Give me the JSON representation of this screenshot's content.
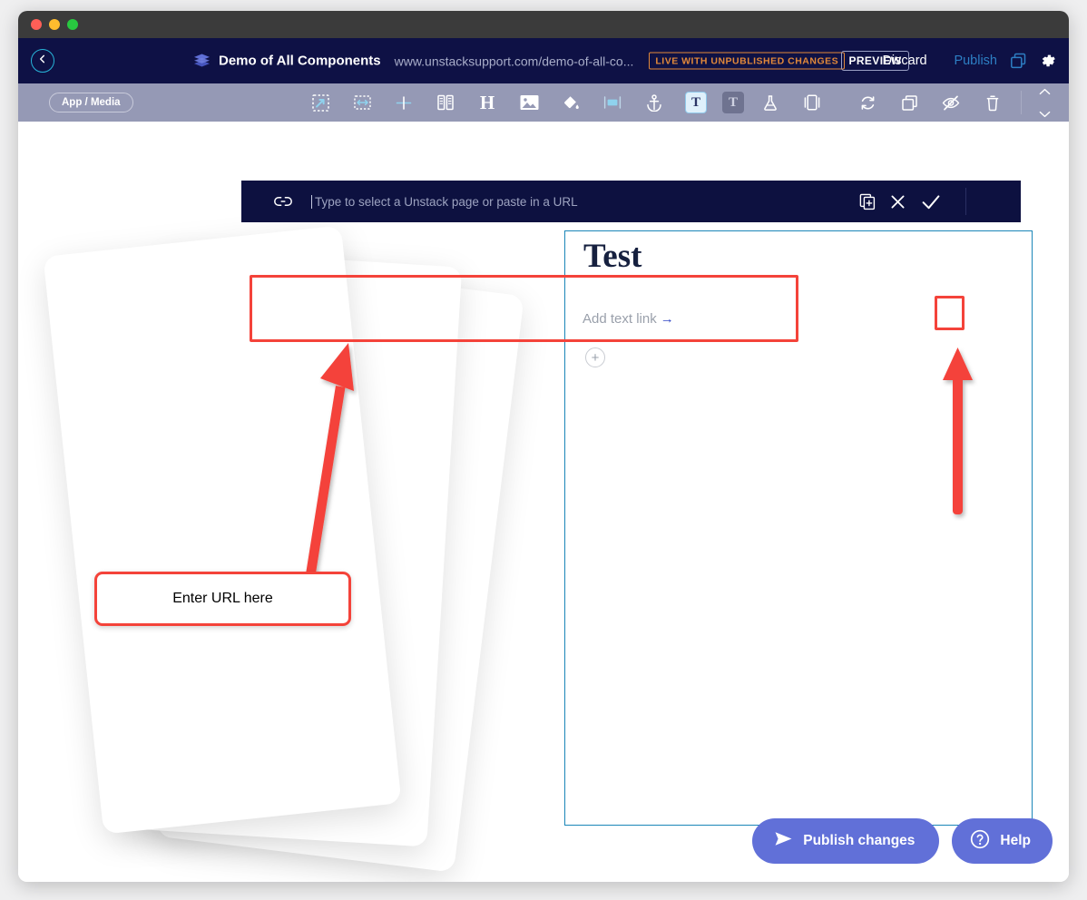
{
  "window": {
    "traffic_lights": [
      "close",
      "minimize",
      "maximize"
    ]
  },
  "header": {
    "back_icon": "chevron-left-icon",
    "logo_icon": "layers-stack-icon",
    "site_title": "Demo of All Components",
    "site_url": "www.unstacksupport.com/demo-of-all-co...",
    "status_badge": "LIVE WITH UNPUBLISHED CHANGES",
    "preview_label": "PREVIEW",
    "discard_label": "Discard",
    "publish_label": "Publish",
    "copy_icon": "duplicate-pages-icon",
    "settings_icon": "gear-icon",
    "accent_badge_color": "#e2893a",
    "publish_link_color": "#2d7fc4"
  },
  "toolbar": {
    "section_pill": "App / Media",
    "tools": [
      {
        "name": "section-expand-icon",
        "label": "Section"
      },
      {
        "name": "horizontal-spacer-icon",
        "label": "Spacer"
      },
      {
        "name": "divider-icon",
        "label": "Divider"
      },
      {
        "name": "columns-icon",
        "label": "Columns"
      },
      {
        "name": "heading-icon",
        "label": "H"
      },
      {
        "name": "image-icon",
        "label": "Image"
      },
      {
        "name": "paint-bucket-icon",
        "label": "Fill"
      },
      {
        "name": "button-icon",
        "label": "Button"
      },
      {
        "name": "anchor-icon",
        "label": "Anchor"
      },
      {
        "name": "text-active-icon",
        "label": "T"
      },
      {
        "name": "text-muted-icon",
        "label": "T"
      },
      {
        "name": "flask-icon",
        "label": "Experiment"
      },
      {
        "name": "carousel-icon",
        "label": "Carousel"
      }
    ],
    "right_tools": [
      {
        "name": "refresh-icon",
        "label": "Refresh"
      },
      {
        "name": "duplicate-icon",
        "label": "Duplicate"
      },
      {
        "name": "hide-eye-icon",
        "label": "Hide"
      },
      {
        "name": "trash-icon",
        "label": "Delete"
      }
    ],
    "move_up_icon": "chevron-up-icon",
    "move_down_icon": "chevron-down-icon"
  },
  "url_dialog": {
    "link_icon": "link-icon",
    "input_value": "",
    "placeholder": "Type to select a Unstack page or paste in a URL",
    "open_new_icon": "open-in-new-window-icon",
    "cancel_icon": "close-x-icon",
    "confirm_icon": "checkmark-icon",
    "background_color": "#0d1140"
  },
  "canvas": {
    "block_title": "Test",
    "add_text_link": "Add text link",
    "add_text_link_arrow": "→",
    "add_block_icon": "plus-circle-icon",
    "selection_border_color": "#1a86b8"
  },
  "annotations": {
    "callout_text": "Enter URL here",
    "highlight_color": "#f4433a",
    "arrow_to_input": "diagonal-arrow-up-right",
    "arrow_to_confirm": "vertical-arrow-up",
    "box_around_input": "url-input-highlight",
    "box_around_confirm": "confirm-button-highlight"
  },
  "footer": {
    "publish_label": "Publish changes",
    "publish_icon": "paper-plane-icon",
    "help_label": "Help",
    "help_icon": "question-circle-icon",
    "button_color": "#6170d8"
  }
}
